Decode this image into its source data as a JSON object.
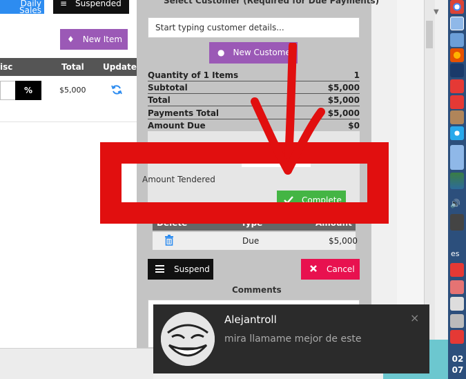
{
  "left": {
    "daily_sales_label": "Daily Sales",
    "suspended_label": "Suspended",
    "new_item_label": "New Item",
    "columns": [
      "isc",
      "Total",
      "Update"
    ],
    "percent_label": "%",
    "row_total": "$5,000"
  },
  "customer": {
    "heading": "Select Customer (Required for Due Payments)",
    "search_placeholder": "Start typing customer details...",
    "new_customer_label": "New Custome"
  },
  "summary": {
    "rows": [
      {
        "label": "Quantity of 1 Items",
        "value": "1"
      },
      {
        "label": "Subtotal",
        "value": "$5,000"
      },
      {
        "label": "Total",
        "value": "$5,000"
      },
      {
        "label": "Payments Total",
        "value": "$5,000"
      },
      {
        "label": "Amount Due",
        "value": "$0"
      }
    ]
  },
  "payment": {
    "tendered_label": "Amount Tendered",
    "complete_label": "Complete",
    "columns": [
      "Delete",
      "Type",
      "Amount"
    ],
    "row": {
      "type": "Due",
      "amount": "$5,000"
    }
  },
  "actions": {
    "suspend_label": "Suspend",
    "cancel_label": "Cancel",
    "comments_label": "Comments"
  },
  "taskbar": {
    "lang": "es",
    "clock_lines": [
      "02",
      "07"
    ]
  },
  "notification": {
    "title": "Alejantroll",
    "message": "mira llamame mejor de este",
    "close_glyph": "×"
  },
  "colors": {
    "annotation_red": "#e10f0f",
    "purple": "#9b59b6",
    "green": "#44b544",
    "danger": "#e8114f"
  }
}
